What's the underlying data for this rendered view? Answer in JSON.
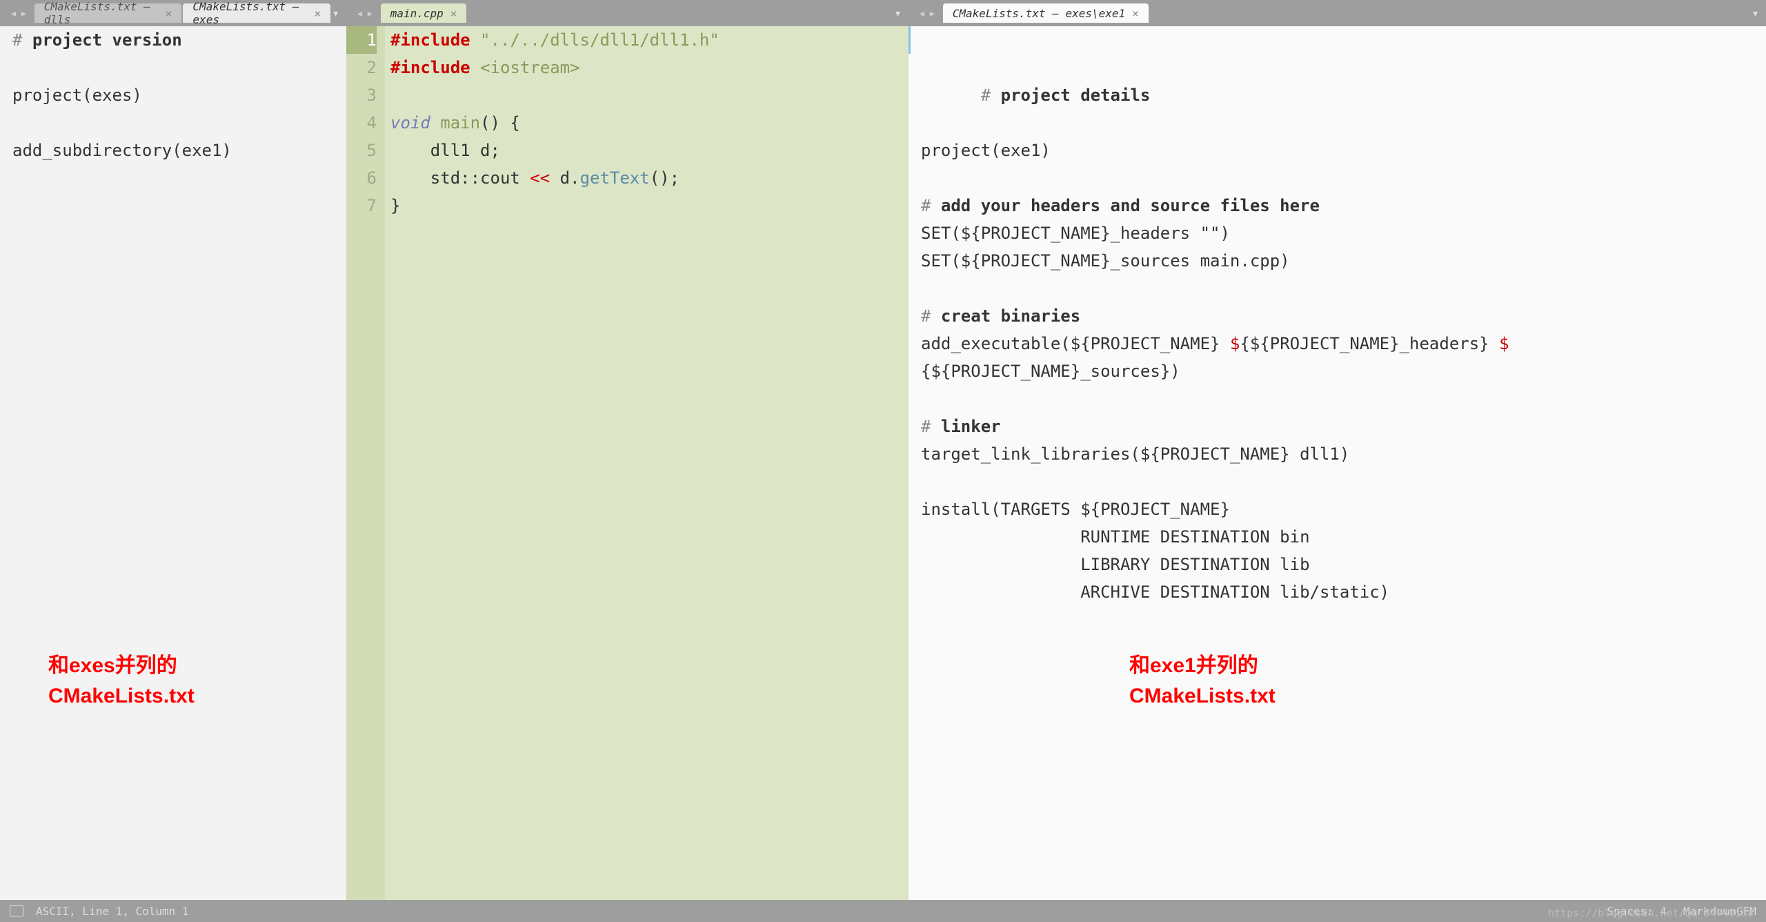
{
  "panes": {
    "left": {
      "tabs": [
        {
          "label": "CMakeLists.txt — dlls",
          "active": false
        },
        {
          "label": "CMakeLists.txt — exes",
          "active": true
        }
      ],
      "code_html": "<span class='kw-comment'>#</span> <span class='kw-bold'>project version</span>\n\nproject(exes)\n\nadd_subdirectory(exe1)",
      "annotation": "和exes并列的\nCMakeLists.txt"
    },
    "middle": {
      "tabs": [
        {
          "label": "main.cpp",
          "active": true
        }
      ],
      "line_count": 7,
      "active_line": 1,
      "code_lines": [
        "<span class='kw-red'>#include</span> <span class='kw-str'>\"../../dlls/dll1/dll1.h\"</span>",
        "<span class='kw-red'>#include</span> <span class='kw-str'>&lt;iostream&gt;</span>",
        "",
        "<span class='kw-type'>void</span> <span class='kw-func'>main</span>() {",
        "    dll1 d;",
        "    std::cout <span class='kw-op'>&lt;&lt;</span> d.<span class='kw-call'>getText</span>();",
        "}"
      ]
    },
    "right": {
      "tabs": [
        {
          "label": "CMakeLists.txt — exes\\exe1",
          "active": true
        }
      ],
      "code_html": "<span class='kw-comment'>#</span> <span class='kw-bold'>project details</span>\n\nproject(exe1)\n\n<span class='kw-comment'>#</span> <span class='kw-bold'>add your headers and source files here</span>\nSET(${PROJECT_NAME}_headers \"\")\nSET(${PROJECT_NAME}_sources main.cpp)\n\n<span class='kw-comment'>#</span> <span class='kw-bold'>creat binaries</span>\nadd_executable(${PROJECT_NAME} <span class='kw-dollar'>$</span>{${PROJECT_NAME}_headers} <span class='kw-dollar'>$</span>\n{${PROJECT_NAME}_sources})\n\n<span class='kw-comment'>#</span> <span class='kw-bold'>linker</span>\ntarget_link_libraries(${PROJECT_NAME} dll1)\n\ninstall(TARGETS ${PROJECT_NAME}\n                RUNTIME DESTINATION bin\n                LIBRARY DESTINATION lib\n                ARCHIVE DESTINATION lib/static)",
      "annotation": "和exe1并列的\nCMakeLists.txt"
    }
  },
  "status": {
    "left": "ASCII, Line 1, Column 1",
    "right_spaces": "Spaces: 4",
    "right_mode": "MarkdownGFM"
  },
  "watermark": "https://blog.csdn.net/qq_34748138"
}
